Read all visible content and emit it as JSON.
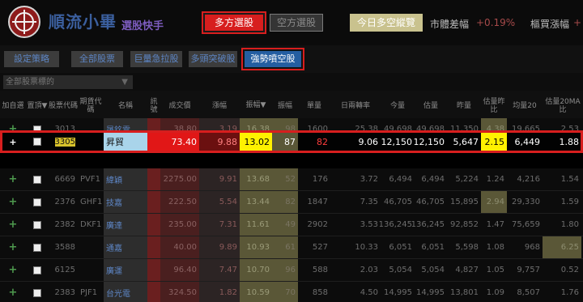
{
  "header": {
    "brand_name": "順流小畢",
    "brand_sub": "選股快手",
    "long_button": "多方選股",
    "short_button": "空方選股",
    "today_button": "今日多空縱覽",
    "market_diff_label": "市體差幅",
    "market_diff_value": "+0.19%",
    "up_ratio_label": "樞買漲幅",
    "up_ratio_value": "+"
  },
  "strategy_tabs": {
    "settings": "設定策略",
    "all": "全部股票",
    "volume_surge": "巨量急拉股",
    "long_breakout": "多頭突破股",
    "strong_short_squeeze": "強勢噴空股"
  },
  "filter": {
    "value": "全部股票標的",
    "arrow": "▼"
  },
  "columns": {
    "add": "加自選",
    "fav": "置頂▼",
    "code": "股票代碼",
    "warrant_code": "期貨代碼",
    "name": "名稱",
    "flag": "訊號",
    "price": "成交價",
    "change": "漲幅",
    "range": "振幅▼",
    "rank": "振幅",
    "units": "單量",
    "turnover": "日兩轉率",
    "today_vol": "今量",
    "est_vol": "估量",
    "yest_vol": "昨量",
    "est_ratio": "估量昨比",
    "avg20": "均量20",
    "est_20ma": "估量20MA比"
  },
  "rows": [
    {
      "add": "+",
      "code": "3013",
      "warrant": "",
      "name": "晟銘電",
      "price": "38.80",
      "change": "3.19",
      "range": "16.38",
      "rank": "98",
      "units": "1600",
      "turnover": "25.38",
      "today_vol": "49,698",
      "est_vol": "49,698",
      "yest_vol": "11,350",
      "est_ratio": "4.38",
      "avg20": "19,665",
      "est_20ma": "2.53"
    },
    {
      "add": "+",
      "code": "3305",
      "warrant": "",
      "name": "昇貿",
      "price": "73.40",
      "change": "9.88",
      "range": "13.02",
      "rank": "87",
      "units": "82",
      "turnover": "9.06",
      "today_vol": "12,150",
      "est_vol": "12,150",
      "yest_vol": "5,647",
      "est_ratio": "2.15",
      "avg20": "6,449",
      "est_20ma": "1.88"
    },
    {
      "add": "+",
      "code": "6669",
      "warrant": "PVF1",
      "name": "緯穎",
      "price": "2275.00",
      "change": "9.91",
      "range": "13.68",
      "rank": "52",
      "units": "176",
      "turnover": "3.72",
      "today_vol": "6,494",
      "est_vol": "6,494",
      "yest_vol": "5,224",
      "est_ratio": "1.24",
      "avg20": "4,216",
      "est_20ma": "1.54"
    },
    {
      "add": "+",
      "code": "2376",
      "warrant": "GHF1",
      "name": "技嘉",
      "price": "222.50",
      "change": "5.54",
      "range": "13.44",
      "rank": "82",
      "units": "1847",
      "turnover": "7.35",
      "today_vol": "46,705",
      "est_vol": "46,705",
      "yest_vol": "15,895",
      "est_ratio": "2.94",
      "avg20": "29,330",
      "est_20ma": "1.59"
    },
    {
      "add": "+",
      "code": "2382",
      "warrant": "DKF1",
      "name": "廣達",
      "price": "235.00",
      "change": "7.31",
      "range": "11.61",
      "rank": "49",
      "units": "2902",
      "turnover": "3.53",
      "today_vol": "136,245",
      "est_vol": "136,245",
      "yest_vol": "92,852",
      "est_ratio": "1.47",
      "avg20": "75,659",
      "est_20ma": "1.80"
    },
    {
      "add": "+",
      "code": "3588",
      "warrant": "",
      "name": "通嘉",
      "price": "40.00",
      "change": "9.89",
      "range": "10.93",
      "rank": "61",
      "units": "527",
      "turnover": "10.33",
      "today_vol": "6,051",
      "est_vol": "6,051",
      "yest_vol": "5,598",
      "est_ratio": "1.08",
      "avg20": "968",
      "est_20ma": "6.25"
    },
    {
      "add": "+",
      "code": "6125",
      "warrant": "",
      "name": "廣運",
      "price": "96.40",
      "change": "7.47",
      "range": "10.70",
      "rank": "96",
      "units": "588",
      "turnover": "2.03",
      "today_vol": "5,054",
      "est_vol": "5,054",
      "yest_vol": "4,827",
      "est_ratio": "1.05",
      "avg20": "9,757",
      "est_20ma": "0.52"
    },
    {
      "add": "+",
      "code": "2383",
      "warrant": "PJF1",
      "name": "台光電",
      "price": "324.50",
      "change": "1.82",
      "range": "10.59",
      "rank": "70",
      "units": "858",
      "turnover": "4.50",
      "today_vol": "14,995",
      "est_vol": "14,995",
      "yest_vol": "13,801",
      "est_ratio": "1.09",
      "avg20": "8,507",
      "est_20ma": "1.76"
    }
  ]
}
